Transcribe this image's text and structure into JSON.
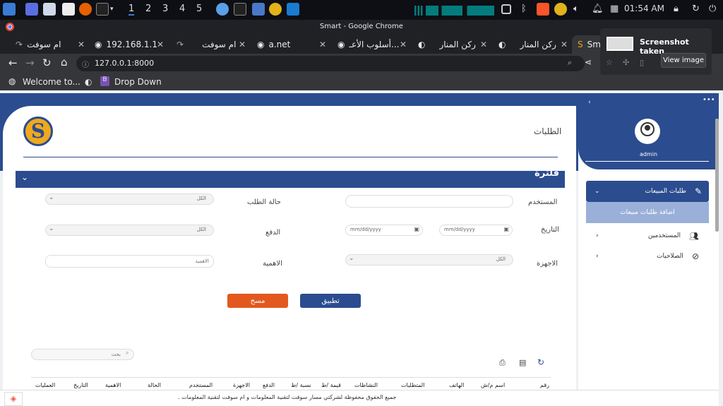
{
  "taskbar": {
    "workspaces": [
      "1",
      "2",
      "3",
      "4",
      "5"
    ],
    "clock": "01:54 AM"
  },
  "window": {
    "title": "Smart - Google Chrome"
  },
  "tabs": [
    {
      "label": "ام سوفت"
    },
    {
      "label": "192.168.1.1"
    },
    {
      "label": "ام سوفت"
    },
    {
      "label": "a.net"
    },
    {
      "label": "أسلوب الأعـ..."
    },
    {
      "label": "ركن المنار"
    },
    {
      "label": "ركن المنار"
    },
    {
      "label": "Sm"
    }
  ],
  "address": {
    "url": "127.0.0.1:8000"
  },
  "bookmarks": [
    {
      "label": "Welcome to..."
    },
    {
      "label": "Drop Down"
    }
  ],
  "toast": {
    "title": "Screenshot taken",
    "button": "View image"
  },
  "header": {
    "title": "الطلبات"
  },
  "filter": {
    "title": "فلترة",
    "labels": {
      "user": "المستخدم",
      "status": "حالة الطلب",
      "date": "التاريخ",
      "payment": "الدفع",
      "devices": "الاجهزة",
      "importance": "الاهمية"
    },
    "values": {
      "status": "الكل",
      "payment": "الكل",
      "devices": "الكل",
      "date_from": "mm/dd/yyyy",
      "date_to": "mm/dd/yyyy"
    },
    "placeholders": {
      "importance": "الاهمية"
    },
    "apply": "تطبيق",
    "clear": "مسح"
  },
  "table": {
    "search_placeholder": "بحث",
    "columns": [
      "رقم",
      "اسم م/ش",
      "الهاتف",
      "المتطلبات",
      "النشاطات",
      "قيمة /ط",
      "نسبة /ط",
      "الدفع",
      "الاجهزة",
      "المستخدم",
      "الحالة",
      "الاهمية",
      "التاريخ",
      "العمليات"
    ]
  },
  "sidebar": {
    "user": "admin",
    "items": [
      {
        "label": "طلبات المبيعات"
      },
      {
        "label": "اضافة طلبات مبيعات"
      },
      {
        "label": "المستخدمين"
      },
      {
        "label": "الصلاحيات"
      }
    ]
  },
  "footer": {
    "text": "جميع الحقوق محفوظة لشركتي مسار سوفت لتقنية المعلومات و ام سوفت لتقنية المعلومات ."
  },
  "colors": {
    "primary": "#2b4c8f",
    "apply": "#2b4c8f",
    "clear": "#e2581f"
  }
}
